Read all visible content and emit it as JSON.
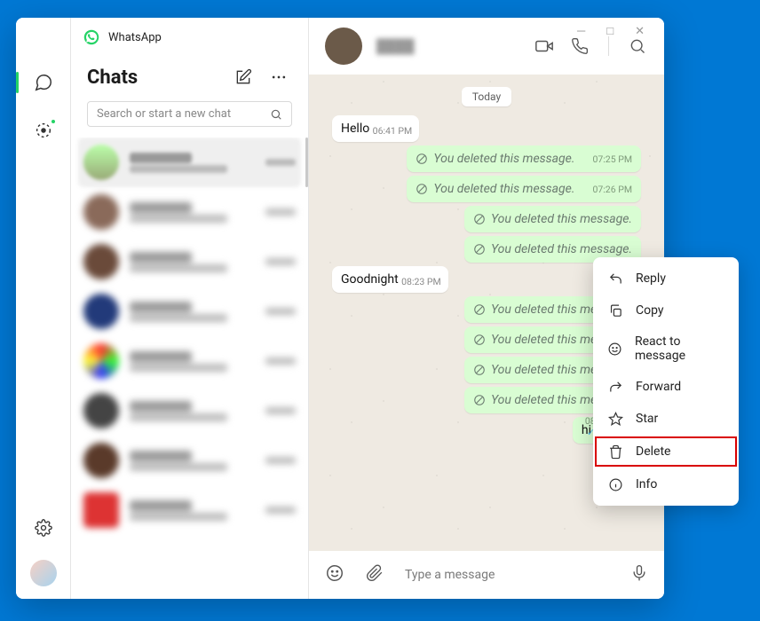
{
  "app": {
    "name": "WhatsApp"
  },
  "sidebar": {
    "title": "Chats",
    "search_placeholder": "Search or start a new chat"
  },
  "conversation": {
    "date_label": "Today",
    "composer_placeholder": "Type a message",
    "messages": [
      {
        "dir": "in",
        "kind": "text",
        "text": "Hello",
        "time": "06:41 PM"
      },
      {
        "dir": "out",
        "kind": "deleted",
        "text": "You deleted this message.",
        "time": "07:25 PM"
      },
      {
        "dir": "out",
        "kind": "deleted",
        "text": "You deleted this message.",
        "time": "07:26 PM"
      },
      {
        "dir": "out",
        "kind": "deleted",
        "text": "You deleted this message.",
        "time": ""
      },
      {
        "dir": "out",
        "kind": "deleted",
        "text": "You deleted this message.",
        "time": ""
      },
      {
        "dir": "in",
        "kind": "text",
        "text": "Goodnight",
        "time": "08:23 PM"
      },
      {
        "dir": "out",
        "kind": "deleted",
        "text": "You deleted this message.",
        "time": ""
      },
      {
        "dir": "out",
        "kind": "deleted",
        "text": "You deleted this message.",
        "time": ""
      },
      {
        "dir": "out",
        "kind": "deleted",
        "text": "You deleted this message.",
        "time": ""
      },
      {
        "dir": "out",
        "kind": "deleted",
        "text": "You deleted this message.",
        "time": ""
      },
      {
        "dir": "out",
        "kind": "text",
        "text": "hi",
        "time": "08:35 PM",
        "ticks": true
      }
    ]
  },
  "context_menu": {
    "items": [
      {
        "icon": "reply-icon",
        "label": "Reply"
      },
      {
        "icon": "copy-icon",
        "label": "Copy"
      },
      {
        "icon": "emoji-icon",
        "label": "React to message"
      },
      {
        "icon": "forward-icon",
        "label": "Forward"
      },
      {
        "icon": "star-icon",
        "label": "Star"
      },
      {
        "icon": "trash-icon",
        "label": "Delete",
        "highlight": true
      },
      {
        "icon": "info-icon",
        "label": "Info"
      }
    ]
  }
}
